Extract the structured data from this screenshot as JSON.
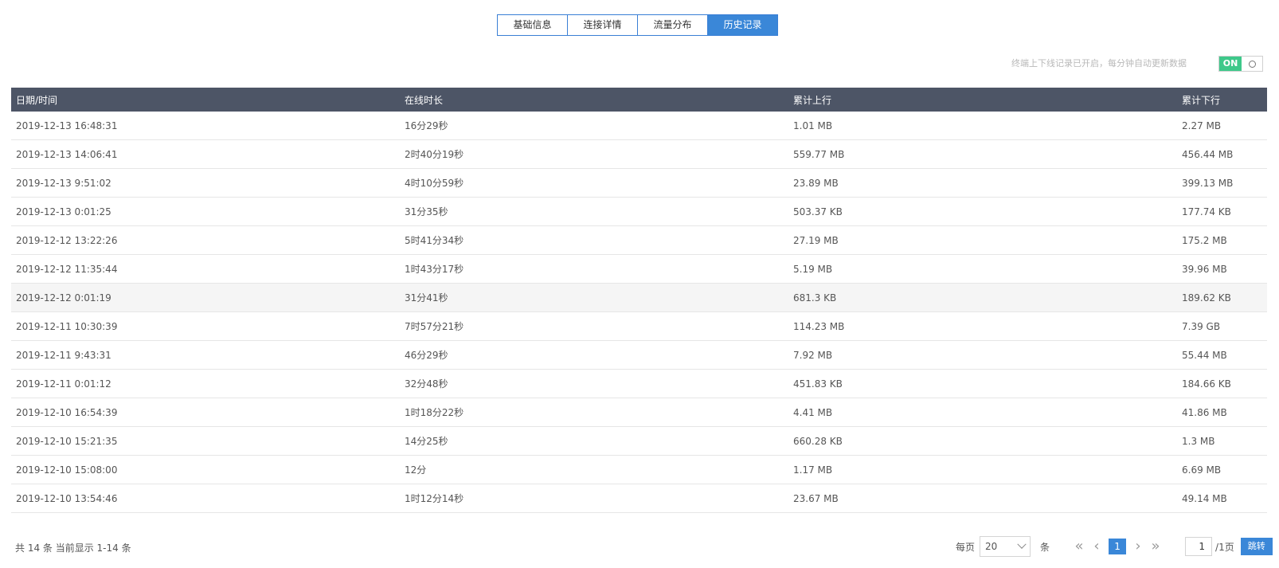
{
  "tabs": [
    {
      "label": "基础信息",
      "active": false
    },
    {
      "label": "连接详情",
      "active": false
    },
    {
      "label": "流量分布",
      "active": false
    },
    {
      "label": "历史记录",
      "active": true
    }
  ],
  "notice": {
    "text": "终端上下线记录已开启，每分钟自动更新数据",
    "toggle_label": "ON",
    "toggle_state": "on",
    "toggle_color": "#3ec88a"
  },
  "table": {
    "headers": [
      "日期/时间",
      "在线时长",
      "累计上行",
      "累计下行"
    ],
    "rows": [
      [
        "2019-12-13 16:48:31",
        "16分29秒",
        "1.01 MB",
        "2.27 MB"
      ],
      [
        "2019-12-13 14:06:41",
        "2时40分19秒",
        "559.77 MB",
        "456.44 MB"
      ],
      [
        "2019-12-13 9:51:02",
        "4时10分59秒",
        "23.89 MB",
        "399.13 MB"
      ],
      [
        "2019-12-13 0:01:25",
        "31分35秒",
        "503.37 KB",
        "177.74 KB"
      ],
      [
        "2019-12-12 13:22:26",
        "5时41分34秒",
        "27.19 MB",
        "175.2 MB"
      ],
      [
        "2019-12-12 11:35:44",
        "1时43分17秒",
        "5.19 MB",
        "39.96 MB"
      ],
      [
        "2019-12-12 0:01:19",
        "31分41秒",
        "681.3 KB",
        "189.62 KB"
      ],
      [
        "2019-12-11 10:30:39",
        "7时57分21秒",
        "114.23 MB",
        "7.39 GB"
      ],
      [
        "2019-12-11 9:43:31",
        "46分29秒",
        "7.92 MB",
        "55.44 MB"
      ],
      [
        "2019-12-11 0:01:12",
        "32分48秒",
        "451.83 KB",
        "184.66 KB"
      ],
      [
        "2019-12-10 16:54:39",
        "1时18分22秒",
        "4.41 MB",
        "41.86 MB"
      ],
      [
        "2019-12-10 15:21:35",
        "14分25秒",
        "660.28 KB",
        "1.3 MB"
      ],
      [
        "2019-12-10 15:08:00",
        "12分",
        "1.17 MB",
        "6.69 MB"
      ],
      [
        "2019-12-10 13:54:46",
        "1时12分14秒",
        "23.67 MB",
        "49.14 MB"
      ]
    ],
    "highlighted_row": 6
  },
  "footer": {
    "summary": "共 14 条 当前显示 1-14 条",
    "per_page_label": "每页",
    "per_page_value": "20",
    "per_page_unit": "条",
    "first_icon": "«",
    "prev_icon": "‹",
    "current_page": "1",
    "next_icon": "›",
    "last_icon": "»",
    "goto_value": "1",
    "total_pages": "/1页",
    "jump_label": "跳转"
  },
  "colors": {
    "accent": "#3a87d8",
    "header_bg": "#4d5566",
    "toggle_on": "#3ec88a"
  }
}
